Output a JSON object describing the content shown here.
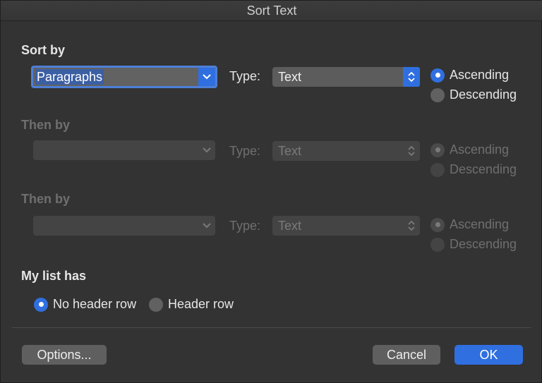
{
  "window": {
    "title": "Sort Text"
  },
  "sort_by": {
    "label": "Sort by",
    "field_value": "Paragraphs",
    "type_label": "Type:",
    "type_value": "Text",
    "ascending_label": "Ascending",
    "descending_label": "Descending",
    "selected_order": "Ascending"
  },
  "then_by_1": {
    "label": "Then by",
    "field_value": "",
    "type_label": "Type:",
    "type_value": "Text",
    "ascending_label": "Ascending",
    "descending_label": "Descending",
    "enabled": false
  },
  "then_by_2": {
    "label": "Then by",
    "field_value": "",
    "type_label": "Type:",
    "type_value": "Text",
    "ascending_label": "Ascending",
    "descending_label": "Descending",
    "enabled": false
  },
  "list_has": {
    "label": "My list has",
    "no_header_label": "No header row",
    "header_label": "Header row",
    "selected": "No header row"
  },
  "buttons": {
    "options_label": "Options...",
    "cancel_label": "Cancel",
    "ok_label": "OK"
  },
  "colors": {
    "accent": "#2f6fe0",
    "background": "#333333",
    "disabled_text": "#6f6f6f"
  },
  "icons": {
    "popup_arrow": "chevron-down-icon",
    "stepper_arrow": "up-down-chevron-icon"
  }
}
